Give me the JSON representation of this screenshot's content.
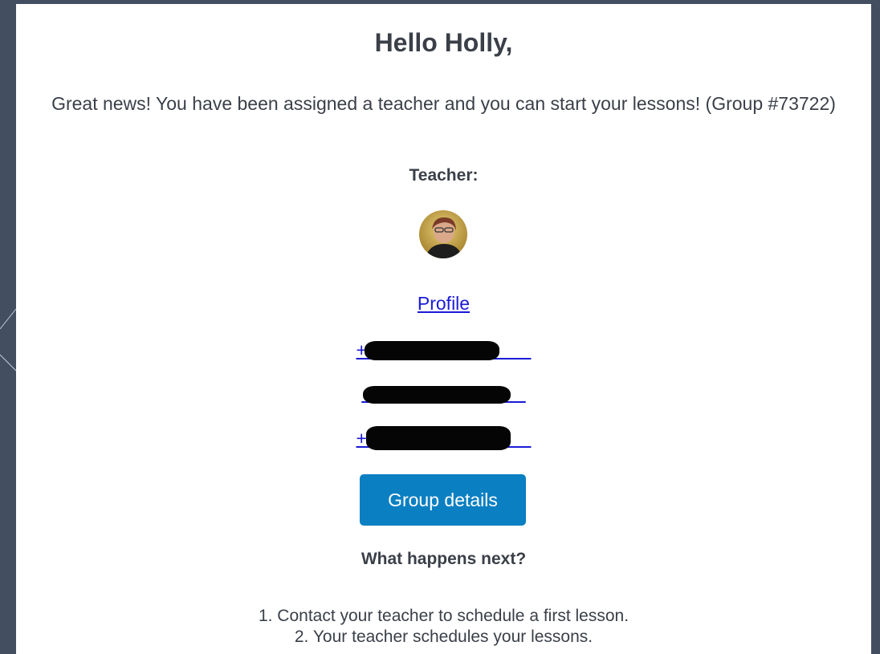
{
  "email": {
    "greeting": "Hello Holly,",
    "intro": "Great news! You have been assigned a teacher and you can start your lessons! (Group #73722)",
    "teacher_label": "Teacher:",
    "profile_link": "Profile",
    "contacts": [
      {
        "text": "+"
      },
      {
        "text": ""
      },
      {
        "text": "+"
      }
    ],
    "group_button": "Group details",
    "next_heading": "What happens next?",
    "steps": [
      "1. Contact your teacher to schedule a first lesson.",
      "2. Your teacher schedules your lessons."
    ]
  },
  "colors": {
    "background": "#434e61",
    "card": "#ffffff",
    "text": "#3a3f48",
    "link": "#1a1ad8",
    "button": "#0a7fc2",
    "redaction": "#050505"
  }
}
